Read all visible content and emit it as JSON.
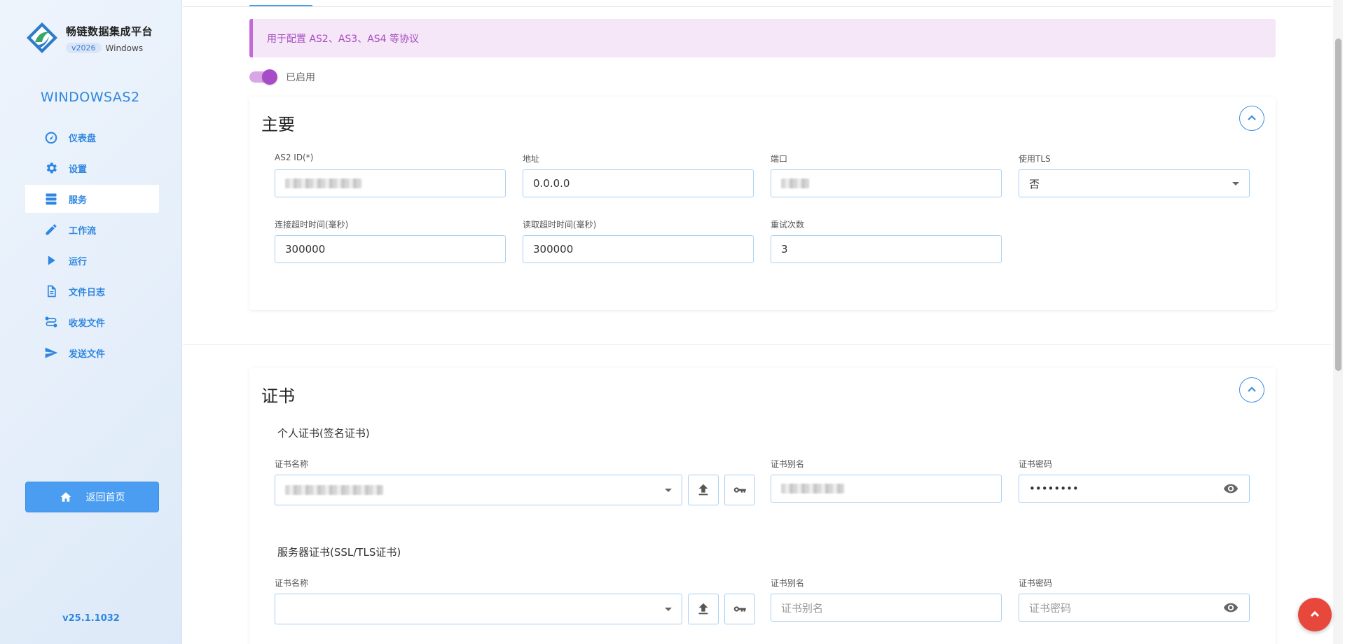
{
  "brand": {
    "title": "畅链数据集成平台",
    "version_badge": "v2026",
    "platform": "Windows"
  },
  "server_name": "WINDOWSAS2",
  "nav": {
    "items": [
      {
        "label": "仪表盘",
        "icon": "speedometer-icon"
      },
      {
        "label": "设置",
        "icon": "gear-icon"
      },
      {
        "label": "服务",
        "icon": "server-icon",
        "active": true
      },
      {
        "label": "工作流",
        "icon": "pencil-icon"
      },
      {
        "label": "运行",
        "icon": "play-icon"
      },
      {
        "label": "文件日志",
        "icon": "document-icon"
      },
      {
        "label": "收发文件",
        "icon": "transfer-icon"
      },
      {
        "label": "发送文件",
        "icon": "send-icon"
      }
    ]
  },
  "home_button": {
    "label": "返回首页",
    "icon": "home-icon"
  },
  "sidebar_version": "v25.1.1032",
  "notice": "用于配置 AS2、AS3、AS4 等协议",
  "enabled_toggle": {
    "label": "已启用",
    "on": true
  },
  "main_section": {
    "title": "主要",
    "fields": {
      "as2_id": {
        "label": "AS2 ID(*)",
        "value": ""
      },
      "address": {
        "label": "地址",
        "value": "0.0.0.0"
      },
      "port": {
        "label": "端口",
        "value": ""
      },
      "use_tls": {
        "label": "使用TLS",
        "value": "否"
      },
      "connect_timeout": {
        "label": "连接超时时间(毫秒)",
        "value": "300000"
      },
      "read_timeout": {
        "label": "读取超时时间(毫秒)",
        "value": "300000"
      },
      "retry_count": {
        "label": "重试次数",
        "value": "3"
      }
    }
  },
  "cert_section": {
    "title": "证书",
    "personal": {
      "title": "个人证书(签名证书)",
      "name_label": "证书名称",
      "name_value": "",
      "alias_label": "证书别名",
      "alias_value": "",
      "password_label": "证书密码",
      "password_value": "••••••••"
    },
    "server": {
      "title": "服务器证书(SSL/TLS证书)",
      "name_label": "证书名称",
      "name_value": "",
      "alias_label": "证书别名",
      "alias_placeholder": "证书别名",
      "password_label": "证书密码",
      "password_placeholder": "证书密码"
    }
  },
  "colors": {
    "accent": "#2f86e0",
    "notice_bg": "#f5e6f8",
    "notice_text": "#a64dc0",
    "toggle": "#a84bc6",
    "fab": "#e8473c"
  }
}
